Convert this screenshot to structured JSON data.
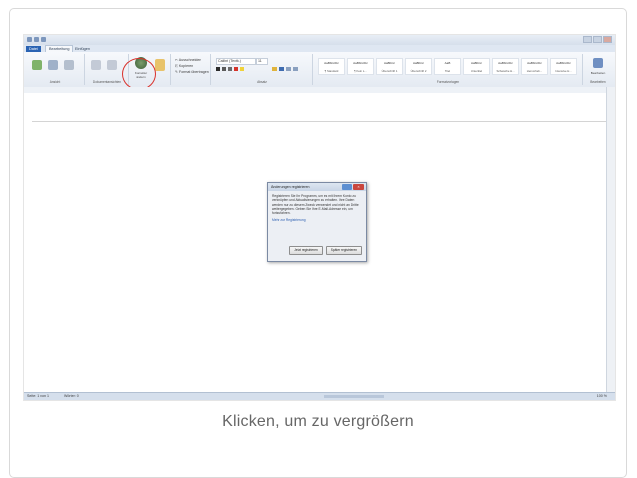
{
  "caption": "Klicken, um zu vergrößern",
  "word": {
    "tabs": [
      "Datei",
      "Bearbeitung",
      "Einfügen"
    ],
    "ribbon_groups": [
      "Ansicht",
      "Dokumentansichten",
      "Absatz",
      "Formatvorlagen",
      "Bearbeiten"
    ],
    "styles": [
      {
        "preview": "AaBbCcDc",
        "name": "¶ Standard"
      },
      {
        "preview": "AaBbCcDc",
        "name": "¶ Kein L..."
      },
      {
        "preview": "AaBbCc",
        "name": "Überschrift 1"
      },
      {
        "preview": "AaBbCc",
        "name": "Überschrift 2"
      },
      {
        "preview": "AaB",
        "name": "Titel"
      },
      {
        "preview": "AaBbCc",
        "name": "Untertitel"
      },
      {
        "preview": "AaBbCcDc",
        "name": "Schwache H..."
      },
      {
        "preview": "AaBbCcDc",
        "name": "Hervorheb..."
      },
      {
        "preview": "AaBbCcDc",
        "name": "Intensive H..."
      }
    ],
    "highlighted_button": "Korrektur ändern",
    "font_name": "Calibri (Textk.)",
    "font_size": "11",
    "edit_button": "Bearbeiten",
    "status_left": "Seite: 1 von 1",
    "status_words": "Wörter: 0",
    "status_zoom": "100 %"
  },
  "dialog": {
    "title": "Änderungen registrieren",
    "body": "Registrieren Sie Ihr Programm, um es mit Ihrem Konto zu verknüpfen und Aktualisierungen zu erhalten. Ihre Daten werden nur zu diesem Zweck verwendet und nicht an Dritte weitergegeben. Geben Sie Ihre E-Mail-Adresse ein, um fortzufahren.",
    "link": "Mehr zur Registrierung",
    "btn_primary": "Jetzt registrieren",
    "btn_secondary": "Später registrieren"
  },
  "colors": {
    "accent_file_tab": "#2a63b3",
    "highlight_circle": "#d9302a"
  }
}
